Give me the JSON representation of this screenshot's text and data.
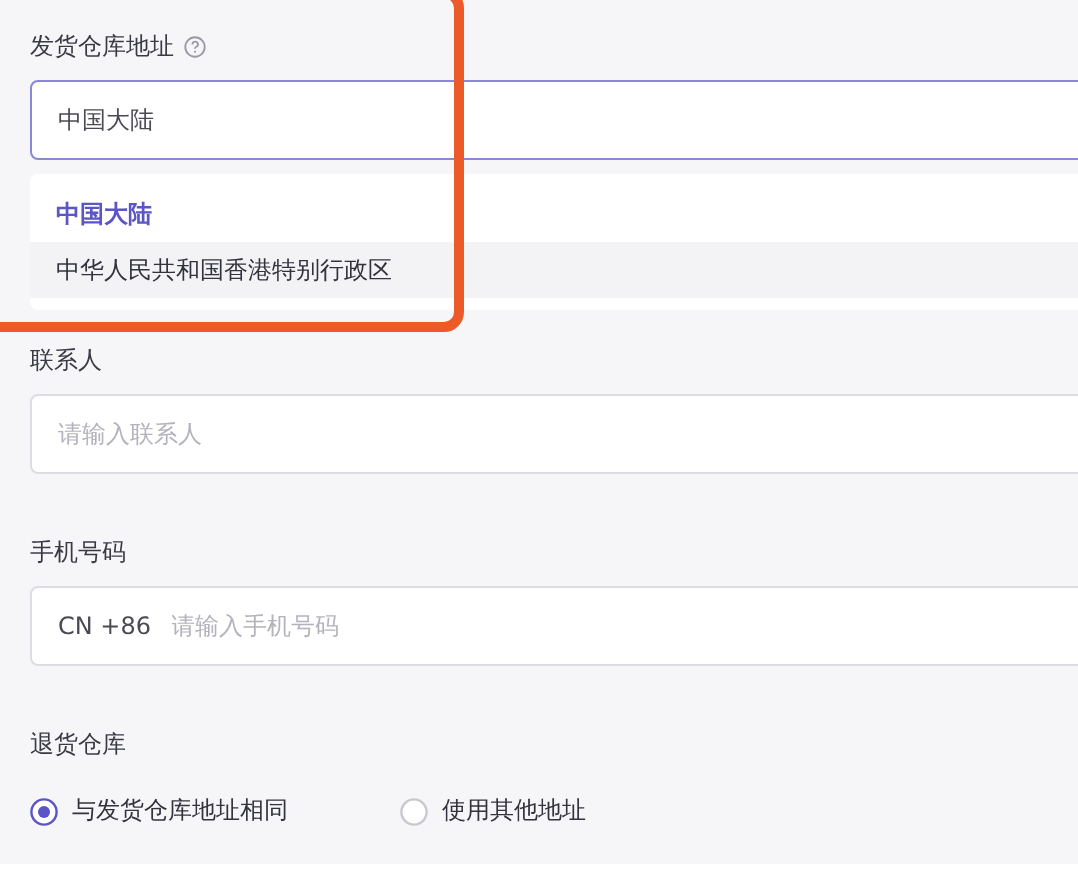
{
  "warehouse": {
    "label": "发货仓库地址",
    "select": {
      "value": "中国大陆",
      "expanded": true
    },
    "options": [
      {
        "label": "中国大陆",
        "selected": true
      },
      {
        "label": "中华人民共和国香港特别行政区",
        "selected": false
      }
    ]
  },
  "contact": {
    "label": "联系人",
    "placeholder": "请输入联系人"
  },
  "phone": {
    "label": "手机号码",
    "prefix": "CN +86",
    "placeholder": "请输入手机号码"
  },
  "return_warehouse": {
    "label": "退货仓库",
    "options": [
      {
        "label": "与发货仓库地址相同",
        "selected": true
      },
      {
        "label": "使用其他地址",
        "selected": false
      }
    ]
  },
  "highlight": true
}
